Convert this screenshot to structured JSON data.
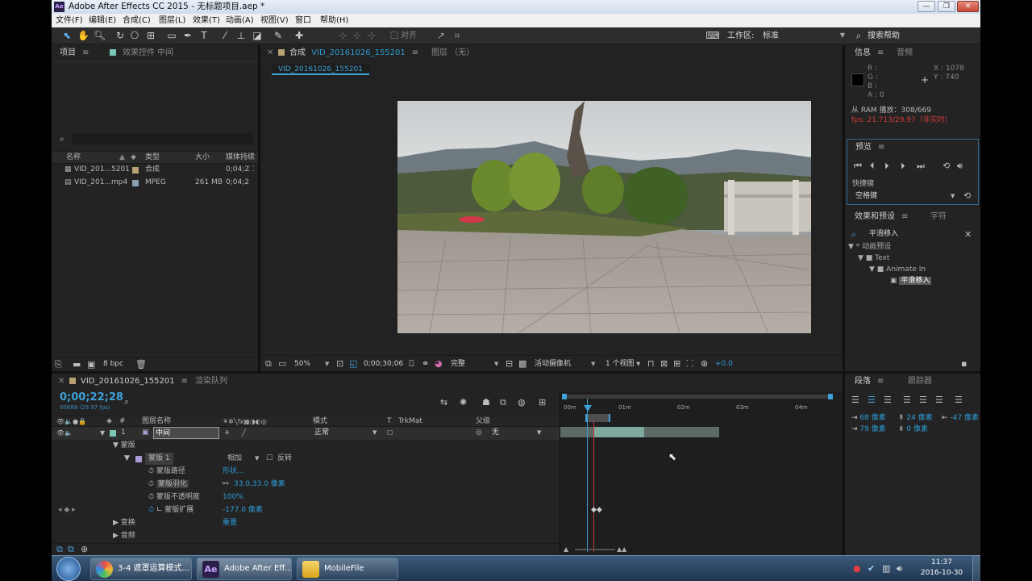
{
  "title": {
    "app_badge": "Ae",
    "text": "Adobe After Effects CC 2015 - 无标题项目.aep *",
    "min": "—",
    "max": "❐",
    "close": "✕"
  },
  "menu": [
    "文件(F)",
    "编辑(E)",
    "合成(C)",
    "图层(L)",
    "效果(T)",
    "动画(A)",
    "视图(V)",
    "窗口",
    "帮助(H)"
  ],
  "toolbar": {
    "align_label": "对齐",
    "workspace_label": "工作区:",
    "workspace_value": "标准",
    "search_help": "搜索帮助"
  },
  "project": {
    "tab": "项目",
    "effects_tab": "效果控件 中间",
    "search_placeholder": "",
    "columns": {
      "name": "名称",
      "type": "类型",
      "size": "大小",
      "duration": "媒体持续"
    },
    "items": [
      {
        "name": "VID_201...5201",
        "type": "合成",
        "size": "",
        "duration": "0;04;2",
        "color": "#b8a172"
      },
      {
        "name": "VID_201...mp4",
        "type": "MPEG",
        "size": "261 MB",
        "duration": "0;04;2",
        "color": "#8d9fb3"
      }
    ],
    "bpc": "8 bpc"
  },
  "comp": {
    "tab_prefix": "合成",
    "tab_name": "VID_20161026_155201",
    "layer_tab": "图层 （无）",
    "flow_tab": "VID_20161026_155201",
    "zoom": "50%",
    "timecode": "0;00;30;06",
    "quality": "完整",
    "camera": "活动摄像机",
    "views": "1 个视图",
    "exposure": "+0.0"
  },
  "info": {
    "tab": "信息",
    "audio_tab": "音频",
    "r": "R :",
    "g": "G :",
    "b": "B :",
    "a": "A : 0",
    "x": "X : 1078",
    "y": "Y : 740",
    "ram": "从 RAM 播放：308/669",
    "fps": "fps: 21.713/29.97（非实时）"
  },
  "preview": {
    "tab": "预览",
    "shortcut_label": "快捷键",
    "shortcut_value": "空格键"
  },
  "effects": {
    "tab": "效果和预设",
    "char_tab": "字符",
    "search": "平滑移入",
    "tree": [
      "* 动画预设",
      "Text",
      "Animate In",
      "平滑移入"
    ]
  },
  "paragraph": {
    "tab": "段落",
    "tracker_tab": "跟踪器",
    "indent_left": "68 像素",
    "indent_right": "-47 像素",
    "indent_first": "79 像素",
    "space_before": "24 像素",
    "space_after": "0 像素"
  },
  "timeline": {
    "tab": "VID_20161026_155201",
    "render_tab": "渲染队列",
    "timecode": "0;00;22;28",
    "frame": "00688 (29.97 fps)",
    "cols": {
      "num": "#",
      "layer_name": "图层名称",
      "mode": "模式",
      "t": "T",
      "trkmat": "TrkMat",
      "parent": "父级"
    },
    "layer": {
      "num": "1",
      "name": "中间",
      "mode": "正常",
      "parent": "无"
    },
    "mask_group": "蒙版",
    "mask_name": "蒙版 1",
    "mask_mode": "相加",
    "invert": "反转",
    "props": [
      {
        "name": "蒙版路径",
        "value": "形状..."
      },
      {
        "name": "蒙版羽化",
        "value": "33.0,33.0 像素"
      },
      {
        "name": "蒙版不透明度",
        "value": "100%"
      },
      {
        "name": "蒙版扩展",
        "value": "-177.0 像素"
      }
    ],
    "transform": "变换",
    "transform_value": "重置",
    "audio": "音频",
    "ruler": [
      "00m",
      "01m",
      "02m",
      "03m",
      "04m"
    ]
  },
  "taskbar": {
    "items": [
      "3-4 遮罩运算模式...",
      "Adobe After Eff...",
      "MobileFile"
    ],
    "time": "11:37",
    "date": "2016-10-30"
  }
}
